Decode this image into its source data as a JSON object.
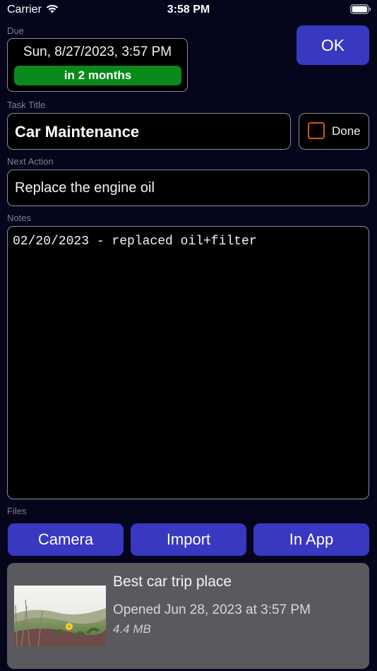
{
  "status_bar": {
    "carrier": "Carrier",
    "time": "3:58 PM",
    "icons": [
      "wifi-icon",
      "battery-icon"
    ]
  },
  "due": {
    "label": "Due",
    "date": "Sun, 8/27/2023, 3:57 PM",
    "relative": "in 2 months",
    "relative_color": "#0a8a1a"
  },
  "ok_button": {
    "label": "OK"
  },
  "task_title": {
    "label": "Task Title",
    "value": "Car Maintenance"
  },
  "done": {
    "label": "Done",
    "checked": false,
    "checkbox_color": "#d0581a"
  },
  "next_action": {
    "label": "Next Action",
    "value": "Replace the engine oil"
  },
  "notes": {
    "label": "Notes",
    "value": "02/20/2023 - replaced oil+filter"
  },
  "files": {
    "label": "Files",
    "buttons": [
      "Camera",
      "Import",
      "In App"
    ],
    "items": [
      {
        "name": "Best car trip place",
        "opened": "Opened Jun 28, 2023 at 3:57 PM",
        "size": "4.4 MB"
      }
    ]
  },
  "colors": {
    "background": "#05061c",
    "accent_button": "#3838c0",
    "label_gray": "#7e7f93",
    "card_bg": "#5a5a5e"
  }
}
